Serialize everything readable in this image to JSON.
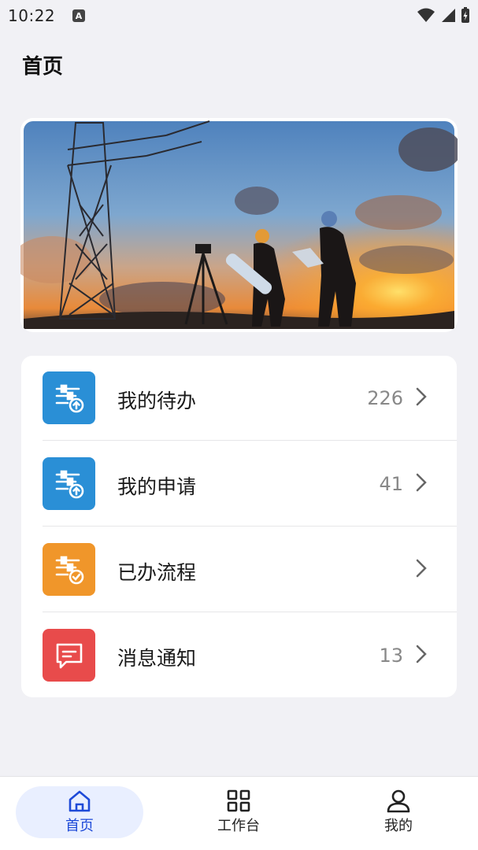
{
  "status_bar": {
    "time": "10:22",
    "notification_badge": "A"
  },
  "header": {
    "title": "首页"
  },
  "menu": {
    "items": [
      {
        "label": "我的待办",
        "count": "226",
        "icon": "task-upload-icon",
        "color": "#2a8fd6"
      },
      {
        "label": "我的申请",
        "count": "41",
        "icon": "apply-upload-icon",
        "color": "#2a8fd6"
      },
      {
        "label": "已办流程",
        "count": "",
        "icon": "done-check-icon",
        "color": "#f0962a"
      },
      {
        "label": "消息通知",
        "count": "13",
        "icon": "message-icon",
        "color": "#e84b4b"
      }
    ]
  },
  "bottom_nav": {
    "items": [
      {
        "label": "首页",
        "icon": "home-icon",
        "active": true
      },
      {
        "label": "工作台",
        "icon": "grid-icon",
        "active": false
      },
      {
        "label": "我的",
        "icon": "user-icon",
        "active": false
      }
    ]
  },
  "colors": {
    "accent": "#1e4ad8",
    "background": "#f1f1f5",
    "card": "#ffffff"
  }
}
